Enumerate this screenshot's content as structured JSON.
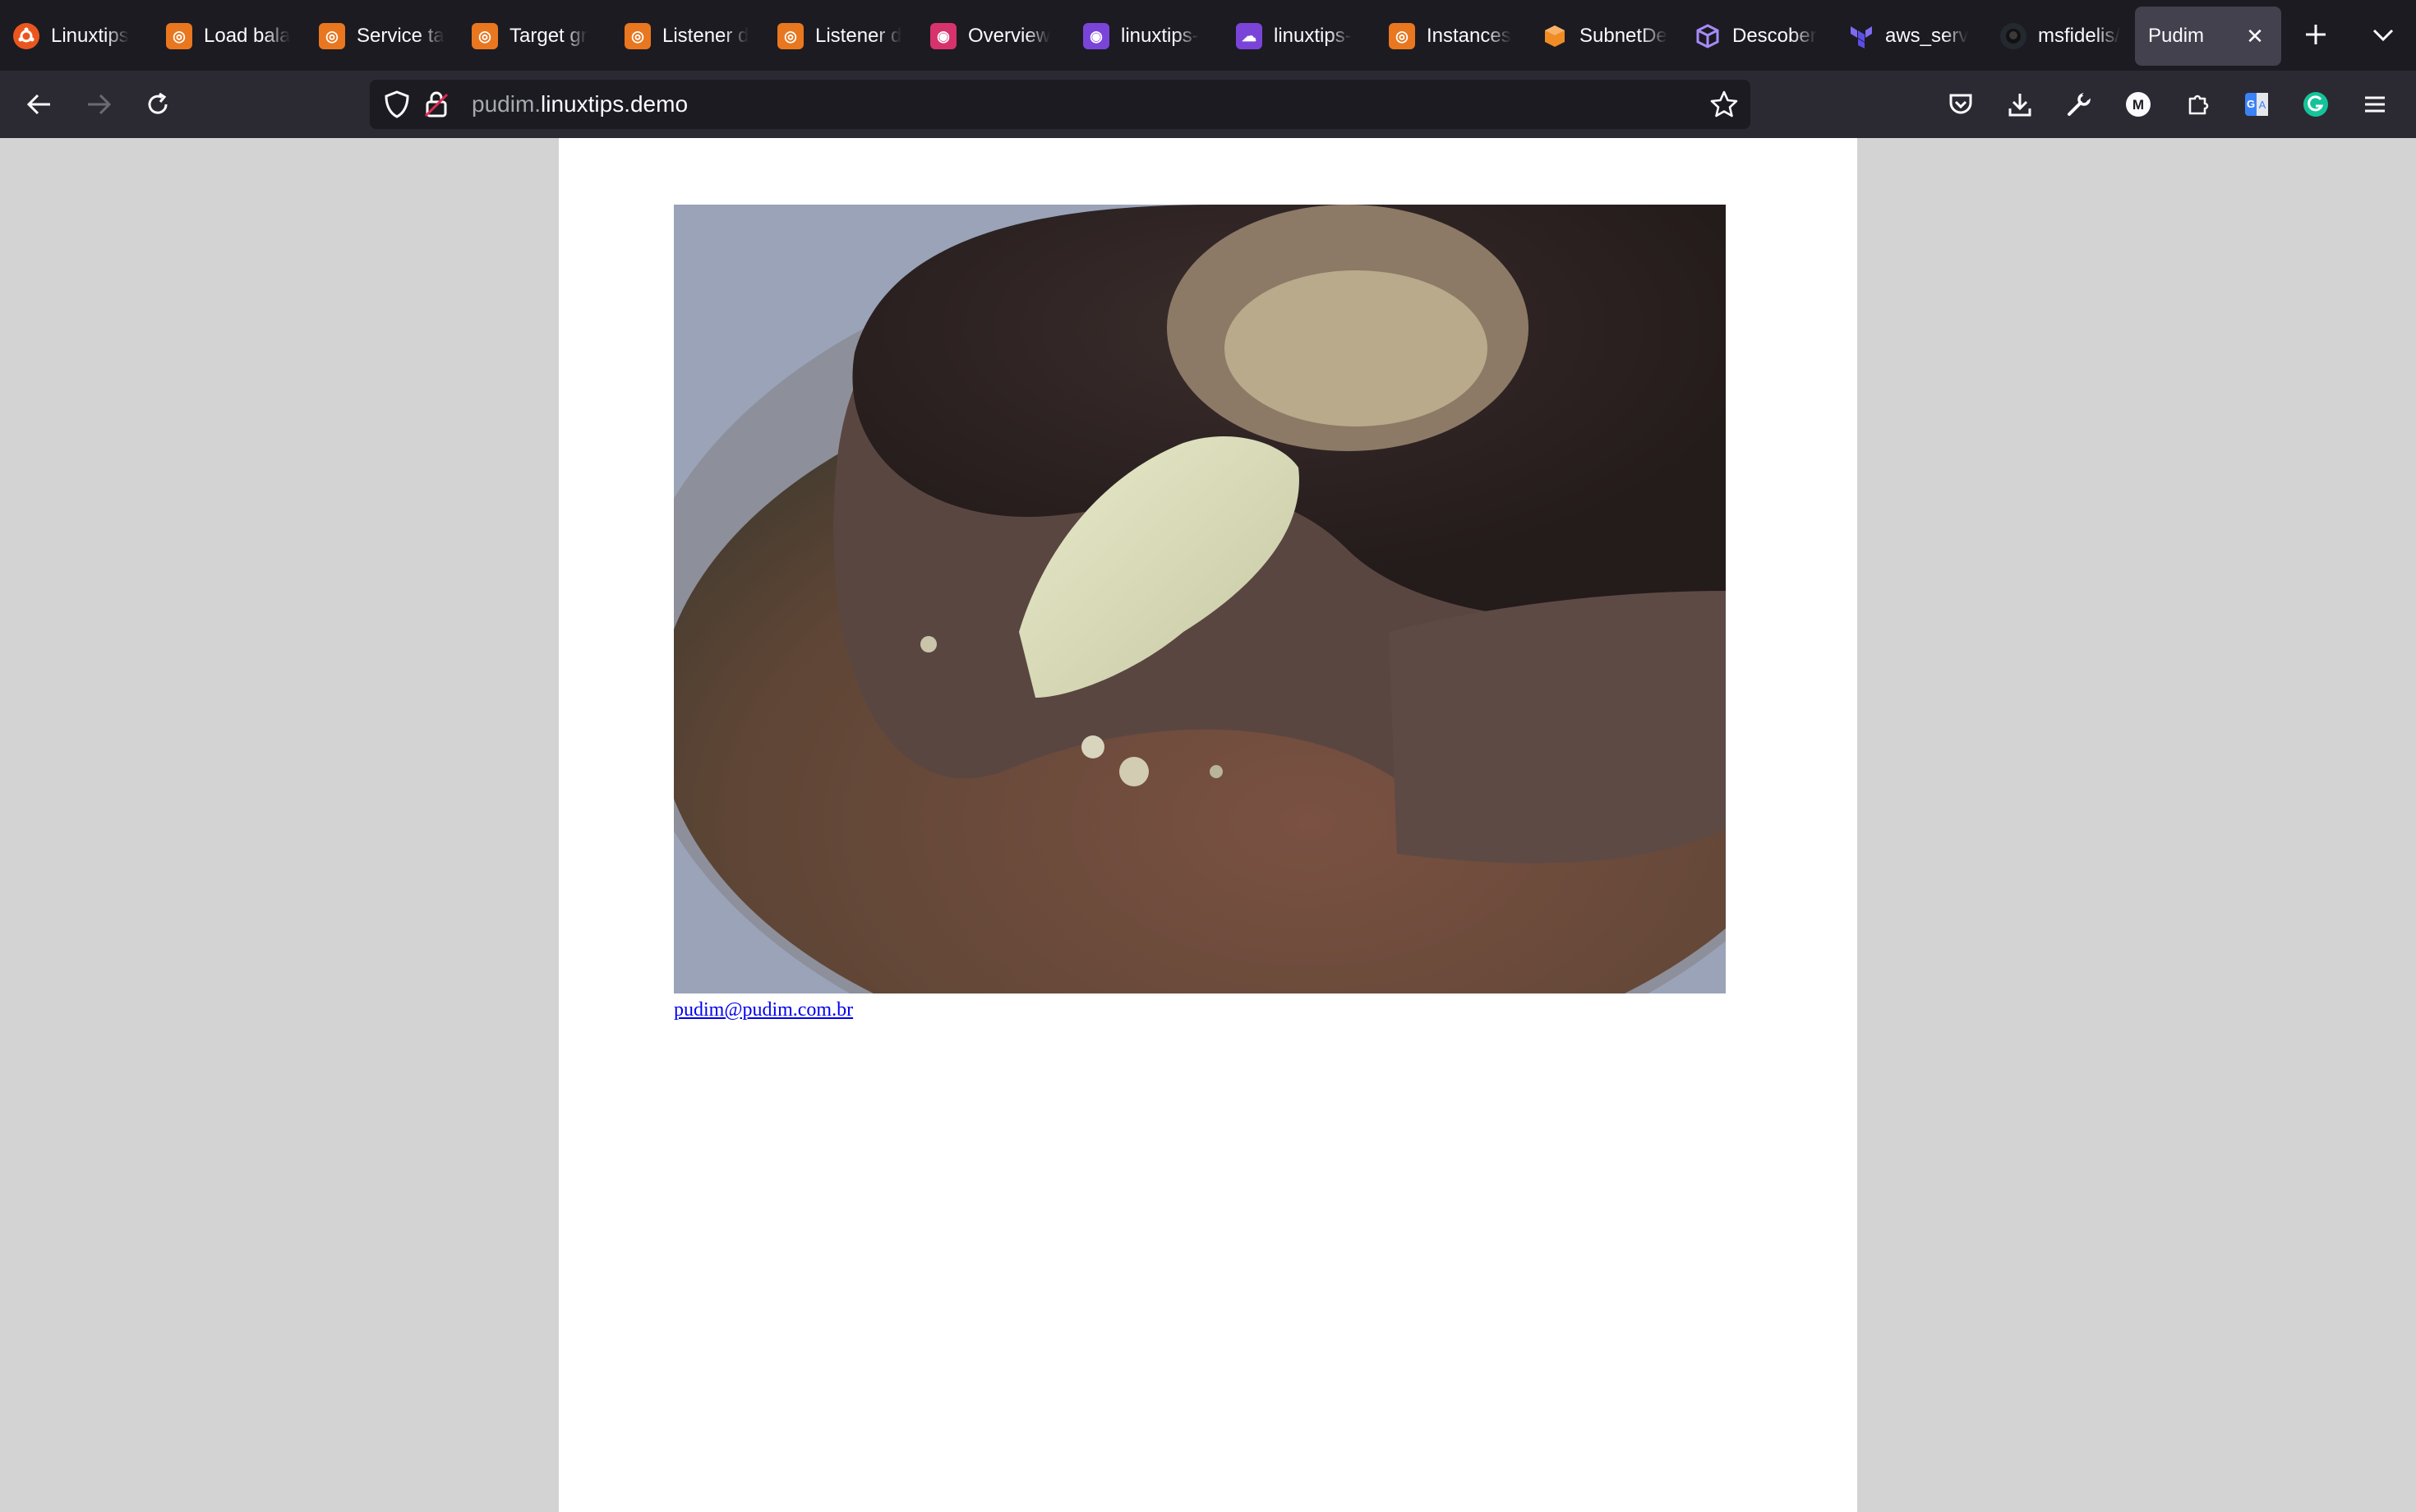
{
  "browser": {
    "tabs": [
      {
        "title": "Linuxtips",
        "color": "#f5a623",
        "active": false
      },
      {
        "title": "Load bala",
        "color": "#e8771f",
        "active": false
      },
      {
        "title": "Service ta",
        "color": "#e8771f",
        "active": false
      },
      {
        "title": "Target gr",
        "color": "#e8771f",
        "active": false
      },
      {
        "title": "Listener d",
        "color": "#e8771f",
        "active": false
      },
      {
        "title": "Listener d",
        "color": "#e8771f",
        "active": false
      },
      {
        "title": "Overview",
        "color": "#d6336c",
        "active": false
      },
      {
        "title": "linuxtips-",
        "color": "#7b44d8",
        "active": false
      },
      {
        "title": "linuxtips-",
        "color": "#7b44d8",
        "active": false
      },
      {
        "title": "Instances",
        "color": "#e8771f",
        "active": false
      },
      {
        "title": "SubnetDe",
        "color": "#f08c24",
        "active": false
      },
      {
        "title": "Descober",
        "color": "#8b5cf6",
        "active": false
      },
      {
        "title": "aws_serv",
        "color": "#5c4ee5",
        "active": false
      },
      {
        "title": "msfidelis/",
        "color": "#24292f",
        "active": false
      },
      {
        "title": "Pudim",
        "color": "",
        "active": true
      }
    ],
    "url": {
      "subdomain": "pudim.",
      "domain": "linuxtips.demo"
    },
    "toolbar_icons": [
      "pocket-icon",
      "download-icon",
      "wrench-icon",
      "extension-m-icon",
      "extensions-icon",
      "translate-icon",
      "grammarly-icon",
      "menu-icon"
    ]
  },
  "page": {
    "image_subject": "pudim",
    "email": "pudim@pudim.com.br"
  }
}
